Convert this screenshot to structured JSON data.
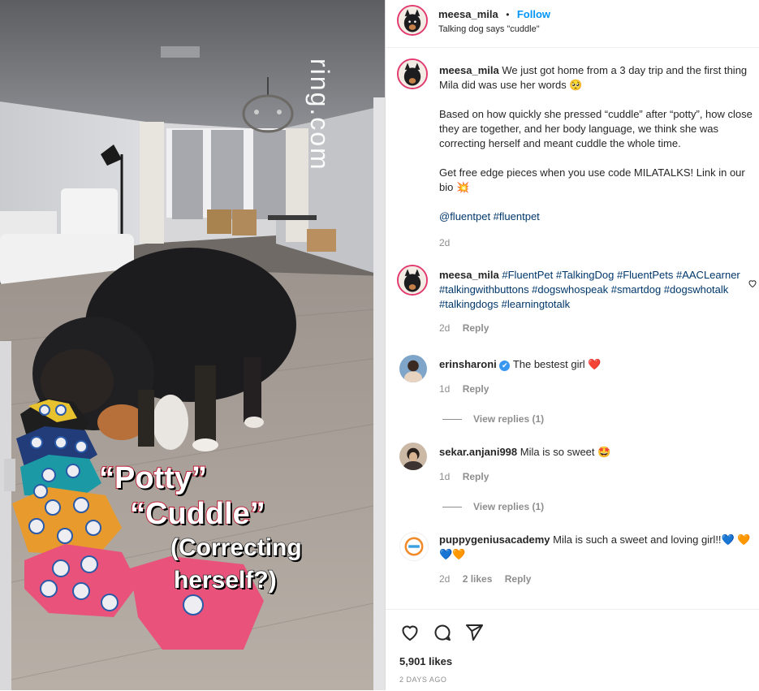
{
  "header": {
    "username": "meesa_mila",
    "separator": "•",
    "follow_label": "Follow",
    "audio_label": "Talking dog says \"cuddle\""
  },
  "video": {
    "watermark": "ring.com",
    "overlay_line1": "“Potty”",
    "overlay_line2": "“Cuddle”",
    "overlay_line3": "(Correcting",
    "overlay_line4": "herself?)"
  },
  "caption": {
    "username": "meesa_mila",
    "para1": "We just got home from a 3 day trip and the first thing Mila did was use her words 🥺",
    "para2": "Based on how quickly she pressed “cuddle” after “potty”, how close they are together, and her body language, we think she was correcting herself and meant cuddle the whole time.",
    "para3": "Get free edge pieces when you use code MILATALKS! Link in our bio 💥",
    "tags": "@fluentpet #fluentpet",
    "time": "2d"
  },
  "comments": [
    {
      "username": "meesa_mila",
      "text": "#FluentPet #TalkingDog #FluentPets #AACLearner #talkingwithbuttons #dogswhospeak #smartdog #dogswhotalk #talkingdogs #learningtotalk",
      "time": "2d",
      "reply": "Reply"
    },
    {
      "username": "erinsharoni",
      "verified": "✔",
      "text": "The bestest girl ❤️",
      "time": "1d",
      "reply": "Reply",
      "view_replies": "View replies (1)"
    },
    {
      "username": "sekar.anjani998",
      "text": "Mila is so sweet 🤩",
      "time": "1d",
      "reply": "Reply",
      "view_replies": "View replies (1)"
    },
    {
      "username": "puppygeniusacademy",
      "text": "Mila is such a sweet and loving girl!!💙 🧡💙🧡",
      "time": "2d",
      "likes": "2 likes",
      "reply": "Reply"
    }
  ],
  "actions": {
    "likes": "5,901 likes",
    "date": "2 DAYS AGO"
  },
  "colors": {
    "link": "#00376b",
    "follow": "#0095f6",
    "muted": "#8e8e8e",
    "heart": "#ed4956"
  }
}
